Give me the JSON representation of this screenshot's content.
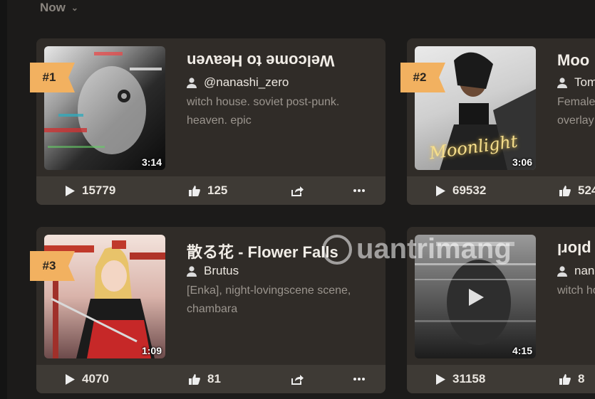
{
  "sort": {
    "label": "Now"
  },
  "cards": [
    {
      "rank": "#1",
      "title": "Welcome to Heaven",
      "author": "@nanashi_zero",
      "description": "witch house. soviet post-punk. heaven. epic",
      "duration": "3:14",
      "plays": "15779",
      "likes": "125"
    },
    {
      "rank": "#2",
      "title": "Moo",
      "author": "Tom",
      "description": "Female\noverlay",
      "duration": "3:06",
      "thumb_text": "Moonlight",
      "plays": "69532",
      "likes": "524"
    },
    {
      "rank": "#3",
      "title": "散る花 - Flower Falls",
      "author": "Brutus",
      "description": "[Enka], night-lovingscene scene, chambara",
      "duration": "1:09",
      "plays": "4070",
      "likes": "81"
    },
    {
      "title": "plorl",
      "author": "nan",
      "description": "witch ho",
      "duration": "4:15",
      "plays": "31158",
      "likes": "8"
    }
  ],
  "watermark": {
    "text": "uantrimang"
  },
  "colors": {
    "background": "#1c1b1a",
    "card": "#302c28",
    "stat_bar": "#3e3a35",
    "rank_badge": "#f2b160"
  }
}
